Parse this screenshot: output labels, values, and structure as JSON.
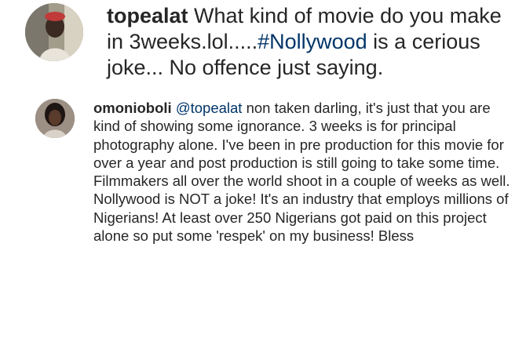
{
  "comments": [
    {
      "username": "topealat",
      "text_before_hashtag": "What kind of movie do you make in 3weeks.lol.....",
      "hashtag": "#Nollywood",
      "text_after_hashtag": " is a cerious joke... No offence just saying."
    },
    {
      "username": "omonioboli",
      "mention": "@topealat",
      "text_after_mention": " non taken darling, it's just that you are kind of showing some ignorance. 3 weeks is for principal photography alone. I've been in pre production for this movie for over a year and post production is still going to take some time. Filmmakers all over the world shoot in a couple of weeks as well. Nollywood is NOT a joke! It's an industry that employs millions of Nigerians! At least over 250 Nigerians got paid on this project alone so put some 'respek' on my business! Bless"
    }
  ],
  "icons": {
    "avatar_1": "user-avatar-photo",
    "avatar_2": "user-avatar-photo"
  }
}
